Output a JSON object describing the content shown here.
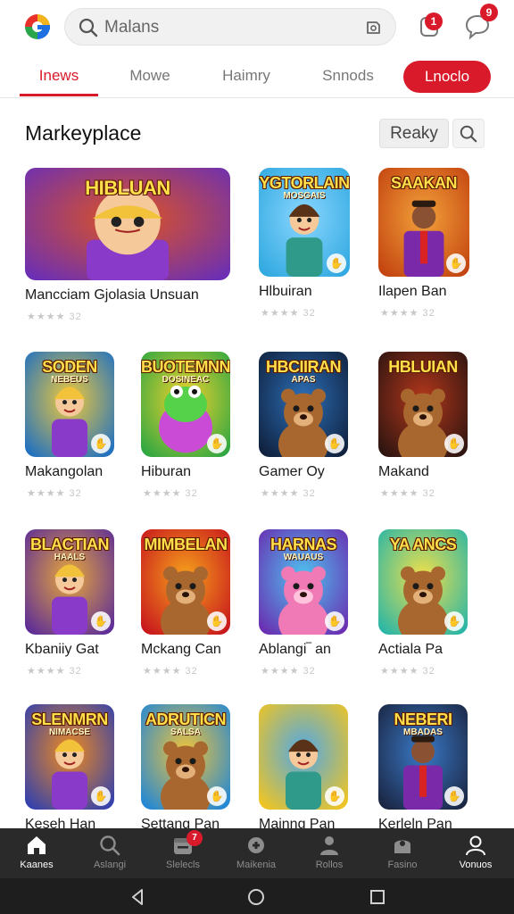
{
  "header": {
    "search_placeholder": "Malans",
    "notification_count": "1",
    "message_count": "9"
  },
  "tabs": [
    {
      "label": "Inews",
      "active": true
    },
    {
      "label": "Mowe",
      "active": false
    },
    {
      "label": "Haimry",
      "active": false
    },
    {
      "label": "Snnods",
      "active": false
    }
  ],
  "tab_button": "Lnoclo",
  "section": {
    "title": "Markeyplace",
    "filter_label": "Reaky"
  },
  "cards": [
    {
      "name": "Mancciam Gjolasia Unsuan",
      "thumb_title": "HIBLUAN",
      "thumb_sub": "",
      "rating_text": "★★★★ 32",
      "rating": 3,
      "bg": "#6b2fb5",
      "bg2": "#e0541e",
      "char": "kid"
    },
    {
      "name": "Hlbuiran",
      "thumb_title": "YGTORLAIN",
      "thumb_sub": "MOSGAIS",
      "rating_text": "★★★★ 32",
      "rating": 3,
      "bg": "#2fa8e0",
      "bg2": "#8ad6ff",
      "char": "girl"
    },
    {
      "name": "Ilapen Ban",
      "thumb_title": "SAAKAN",
      "thumb_sub": "",
      "rating_text": "★★★★ 32",
      "rating": 3,
      "bg": "#c2420f",
      "bg2": "#f3a23a",
      "char": "man"
    },
    {
      "name": "Makangolan",
      "thumb_title": "SODEN",
      "thumb_sub": "NEBEUS",
      "rating_text": "★★★★ 32",
      "rating": 3,
      "bg": "#1c6fc4",
      "bg2": "#f0c93a",
      "char": "kid"
    },
    {
      "name": "Hiburan",
      "thumb_title": "BUOTEMNN",
      "thumb_sub": "DOSINEAC",
      "rating_text": "★★★★ 32",
      "rating": 3,
      "bg": "#2aa642",
      "bg2": "#f2d22e",
      "char": "frog"
    },
    {
      "name": "Gamer Oy",
      "thumb_title": "HBCIIRAN",
      "thumb_sub": "APAS",
      "rating_text": "★★★★ 32",
      "rating": 3,
      "bg": "#0f1f3a",
      "bg2": "#2c6fb8",
      "char": "bear"
    },
    {
      "name": "Makand",
      "thumb_title": "HBLUIAN",
      "thumb_sub": "",
      "rating_text": "★★★★ 32",
      "rating": 3,
      "bg": "#2a1410",
      "bg2": "#b5371c",
      "char": "bear"
    },
    {
      "name": "Kbaniiy Gat",
      "thumb_title": "BLACTIAN",
      "thumb_sub": "HAALS",
      "rating_text": "★★★★ 32",
      "rating": 3,
      "bg": "#5a2a9a",
      "bg2": "#e8a83a",
      "char": "kid"
    },
    {
      "name": "Mckang Can",
      "thumb_title": "MIMBELAN",
      "thumb_sub": "",
      "rating_text": "★★★★ 32",
      "rating": 3,
      "bg": "#c7141c",
      "bg2": "#f6a21c",
      "char": "bear"
    },
    {
      "name": "Ablangi‾ an",
      "thumb_title": "HARNAS",
      "thumb_sub": "WAUAUS",
      "rating_text": "★★★★ 32",
      "rating": 3,
      "bg": "#6a2bb0",
      "bg2": "#4ec4f0",
      "char": "pinkbear"
    },
    {
      "name": "Actiala Pa",
      "thumb_title": "YA ANCS",
      "thumb_sub": "",
      "rating_text": "★★★★ 32",
      "rating": 3,
      "bg": "#26b5a8",
      "bg2": "#f2e04a",
      "char": "bear"
    },
    {
      "name": "Keseh Han",
      "thumb_title": "SLENMRN",
      "thumb_sub": "NIMACSE",
      "rating_text": "★★★★ 32",
      "rating": 3,
      "bg": "#2f3fb0",
      "bg2": "#f08a1e",
      "char": "kid"
    },
    {
      "name": "Settang Pan",
      "thumb_title": "ADRUTICN",
      "thumb_sub": "SALSA",
      "rating_text": "★★★★ 32",
      "rating": 3,
      "bg": "#1e86d8",
      "bg2": "#f2c43a",
      "char": "bear"
    },
    {
      "name": "Mainng Pan",
      "thumb_title": "",
      "thumb_sub": "",
      "rating_text": "★★★★ 32",
      "rating": 3,
      "bg": "#f3c51e",
      "bg2": "#4fa8e8",
      "char": "girl"
    },
    {
      "name": "Kerleln Pan",
      "thumb_title": "NEBERI",
      "thumb_sub": "MBADAS",
      "rating_text": "★★★★ 32",
      "rating": 3,
      "bg": "#1a2440",
      "bg2": "#3a7ac8",
      "char": "man"
    }
  ],
  "bottom_nav": [
    {
      "label": "Kaanes",
      "icon": "home-icon",
      "active": true,
      "badge": ""
    },
    {
      "label": "Aslangi",
      "icon": "search-icon",
      "active": false,
      "badge": ""
    },
    {
      "label": "Slelecls",
      "icon": "calendar-icon",
      "active": false,
      "badge": "7"
    },
    {
      "label": "Maikenia",
      "icon": "gamepad-icon",
      "active": false,
      "badge": ""
    },
    {
      "label": "Rollos",
      "icon": "people-icon",
      "active": false,
      "badge": ""
    },
    {
      "label": "Fasino",
      "icon": "store-icon",
      "active": false,
      "badge": ""
    },
    {
      "label": "Vonuos",
      "icon": "profile-icon",
      "active": true,
      "badge": ""
    }
  ],
  "colors": {
    "accent": "#d91a2a",
    "nav_bg": "#2a2a2a"
  }
}
